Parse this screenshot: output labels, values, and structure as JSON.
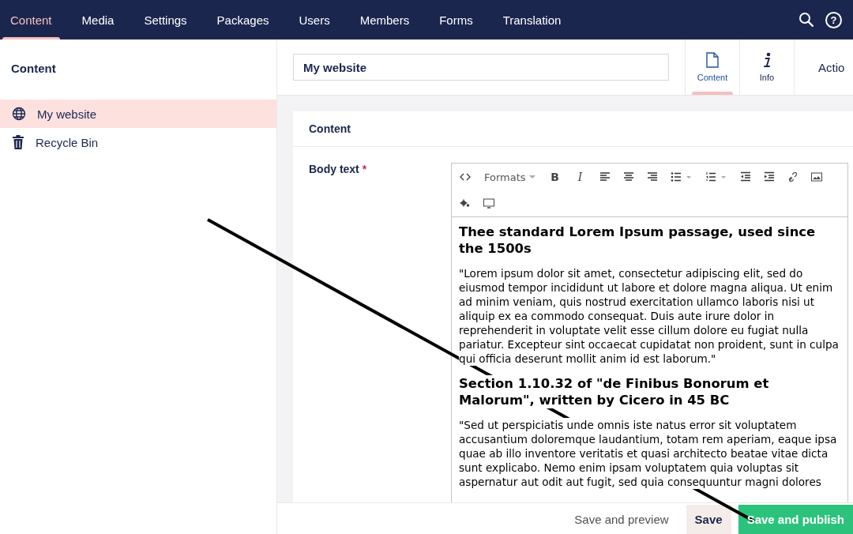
{
  "top_nav": {
    "sections": [
      {
        "label": "Content",
        "selected": true
      },
      {
        "label": "Media",
        "selected": false
      },
      {
        "label": "Settings",
        "selected": false
      },
      {
        "label": "Packages",
        "selected": false
      },
      {
        "label": "Users",
        "selected": false
      },
      {
        "label": "Members",
        "selected": false
      },
      {
        "label": "Forms",
        "selected": false
      },
      {
        "label": "Translation",
        "selected": false
      }
    ],
    "help_label": "?"
  },
  "sidebar": {
    "title": "Content",
    "items": [
      {
        "label": "My website",
        "kind": "site",
        "selected": true
      },
      {
        "label": "Recycle Bin",
        "kind": "bin",
        "selected": false
      }
    ]
  },
  "document": {
    "name": "My website",
    "apps": [
      {
        "label": "Content",
        "kind": "document",
        "selected": true
      },
      {
        "label": "Info",
        "kind": "info",
        "selected": false
      }
    ],
    "actions_label": "Actio"
  },
  "group": {
    "title": "Content",
    "properties": [
      {
        "label": "Body text",
        "required": true,
        "required_mark": "*",
        "editor": {
          "toolbar": [
            {
              "kind": "code"
            },
            {
              "kind": "formats",
              "label": "Formats"
            },
            {
              "kind": "bold",
              "label": "B"
            },
            {
              "kind": "italic",
              "label": "I"
            },
            {
              "kind": "align-left"
            },
            {
              "kind": "align-center"
            },
            {
              "kind": "align-right"
            },
            {
              "kind": "bullets"
            },
            {
              "kind": "numbers"
            },
            {
              "kind": "outdent"
            },
            {
              "kind": "indent"
            },
            {
              "kind": "link"
            },
            {
              "kind": "image"
            },
            {
              "kind": "macro"
            },
            {
              "kind": "embed"
            }
          ],
          "blocks": [
            {
              "kind": "heading",
              "text": "Thee standard Lorem Ipsum passage, used since the 1500s"
            },
            {
              "kind": "paragraph",
              "text": "\"Lorem ipsum dolor sit amet, consectetur adipiscing elit, sed do eiusmod tempor incididunt ut labore et dolore magna aliqua. Ut enim ad minim veniam, quis nostrud exercitation ullamco laboris nisi ut aliquip ex ea commodo consequat. Duis aute irure dolor in reprehenderit in voluptate velit esse cillum dolore eu fugiat nulla pariatur. Excepteur sint occaecat cupidatat non proident, sunt in culpa qui officia deserunt mollit anim id est laborum.\""
            },
            {
              "kind": "heading",
              "text": "Section 1.10.32 of \"de Finibus Bonorum et Malorum\", written by Cicero in 45 BC"
            },
            {
              "kind": "paragraph",
              "text": "\"Sed ut perspiciatis unde omnis iste natus error sit voluptatem accusantium doloremque laudantium, totam rem aperiam, eaque ipsa quae ab illo inventore veritatis et quasi architecto beatae vitae dicta sunt explicabo. Nemo enim ipsam voluptatem quia voluptas sit aspernatur aut odit aut fugit, sed quia consequuntur magni dolores"
            }
          ]
        }
      }
    ]
  },
  "footer": {
    "buttons": [
      {
        "label": "Save and preview",
        "kind": "link"
      },
      {
        "label": "Save",
        "kind": "secondary"
      },
      {
        "label": "Save and publish",
        "kind": "primary"
      }
    ]
  }
}
